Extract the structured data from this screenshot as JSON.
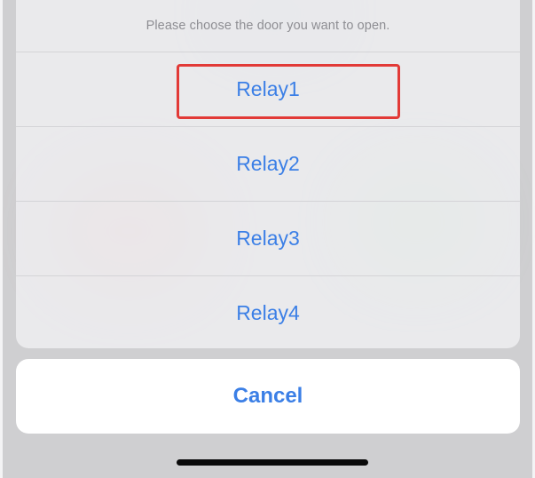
{
  "action_sheet": {
    "message": "Please choose the door you want to open.",
    "options": [
      {
        "label": "Relay1",
        "highlighted": true
      },
      {
        "label": "Relay2",
        "highlighted": false
      },
      {
        "label": "Relay3",
        "highlighted": false
      },
      {
        "label": "Relay4",
        "highlighted": false
      }
    ],
    "cancel_label": "Cancel"
  },
  "colors": {
    "accent": "#3b7fe6",
    "highlight_outline": "#e23a37",
    "message_text": "#8e8e93",
    "sheet_background": "#ececee",
    "cancel_background": "#ffffff"
  }
}
